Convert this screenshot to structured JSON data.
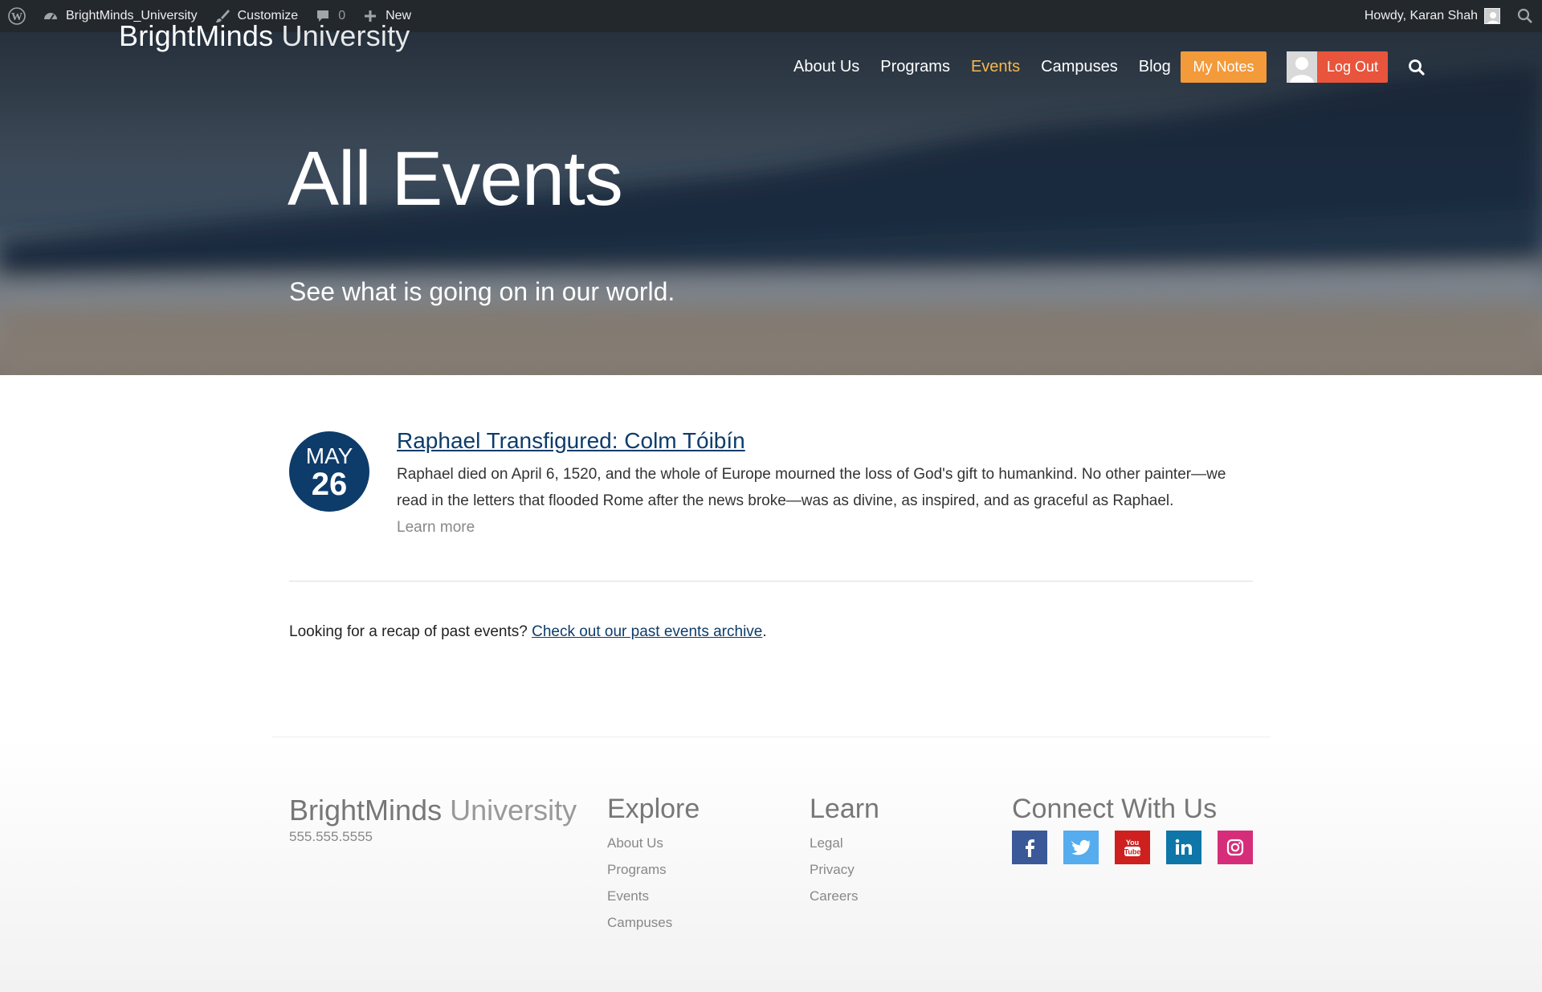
{
  "adminbar": {
    "site_name": "BrightMinds_University",
    "customize_label": "Customize",
    "comments_count": "0",
    "new_label": "New",
    "howdy": "Howdy, Karan Shah"
  },
  "header": {
    "logo_bold": "BrightMinds",
    "logo_light": "University",
    "nav": [
      {
        "label": "About Us"
      },
      {
        "label": "Programs"
      },
      {
        "label": "Events"
      },
      {
        "label": "Campuses"
      },
      {
        "label": "Blog"
      }
    ],
    "active_nav": "Events",
    "my_notes_label": "My Notes",
    "logout_label": "Log Out"
  },
  "hero": {
    "title": "All Events",
    "subtitle": "See what is going on in our world."
  },
  "event": {
    "month": "MAY",
    "day": "26",
    "title": "Raphael Transfigured: Colm Tóibín",
    "description": "Raphael died on April 6, 1520, and the whole of Europe mourned the loss of God's gift to humankind. No other painter—we read in the letters that flooded Rome after the news broke—was as divine, as inspired, and as graceful as Raphael.",
    "learn_more": "Learn more"
  },
  "recap": {
    "text": "Looking for a recap of past events? ",
    "link": "Check out our past events archive",
    "end": "."
  },
  "footer": {
    "logo_bold": "BrightMinds",
    "logo_light": "University",
    "phone": "555.555.5555",
    "explore": {
      "heading": "Explore",
      "links": [
        "About Us",
        "Programs",
        "Events",
        "Campuses"
      ]
    },
    "learn": {
      "heading": "Learn",
      "links": [
        "Legal",
        "Privacy",
        "Careers"
      ]
    },
    "connect": {
      "heading": "Connect With Us",
      "icons": [
        "facebook-icon",
        "twitter-icon",
        "youtube-icon",
        "linkedin-icon",
        "instagram-icon"
      ]
    }
  },
  "colors": {
    "nav_active": "#f7b84b",
    "my_notes": "#f39a3b",
    "logout": "#e8553c",
    "brand_navy": "#0d3c6b",
    "facebook": "#3b5998",
    "twitter": "#55acee",
    "youtube": "#cd201f",
    "linkedin": "#0e76a8",
    "instagram": "#d62d7a"
  }
}
